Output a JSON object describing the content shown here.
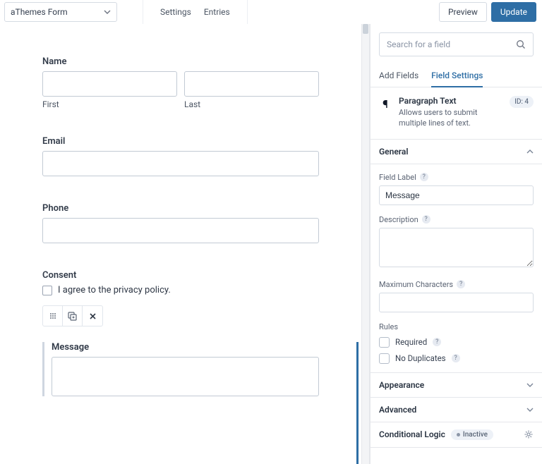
{
  "topbar": {
    "formName": "aThemes Form",
    "links": {
      "settings": "Settings",
      "entries": "Entries"
    },
    "preview": "Preview",
    "update": "Update"
  },
  "canvas": {
    "name": {
      "label": "Name",
      "firstSub": "First",
      "lastSub": "Last"
    },
    "email": {
      "label": "Email"
    },
    "phone": {
      "label": "Phone"
    },
    "consent": {
      "label": "Consent",
      "text": "I agree to the privacy policy."
    },
    "message": {
      "label": "Message"
    }
  },
  "sidebar": {
    "searchPlaceholder": "Search for a field",
    "tabs": {
      "add": "Add Fields",
      "settings": "Field Settings"
    },
    "fieldCard": {
      "title": "Paragraph Text",
      "desc": "Allows users to submit multiple lines of text.",
      "id": "ID: 4"
    },
    "sections": {
      "general": "General",
      "appearance": "Appearance",
      "advanced": "Advanced",
      "conditional": "Conditional Logic"
    },
    "general": {
      "fieldLabel": "Field Label",
      "fieldLabelValue": "Message",
      "description": "Description",
      "maxChars": "Maximum Characters",
      "rules": "Rules",
      "required": "Required",
      "noDup": "No Duplicates"
    },
    "conditionalStatus": "Inactive"
  }
}
